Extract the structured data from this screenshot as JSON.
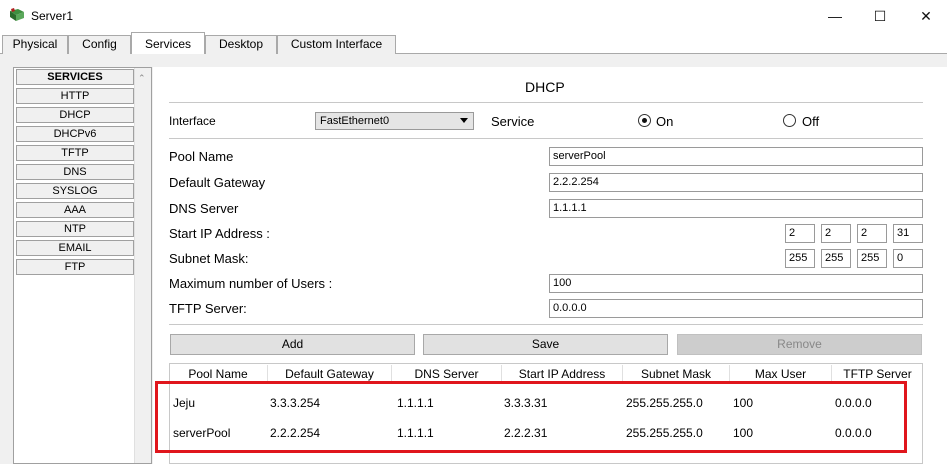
{
  "window": {
    "title": "Server1",
    "minimize": "—",
    "maximize": "☐",
    "close": "✕"
  },
  "tabs": [
    {
      "label": "Physical"
    },
    {
      "label": "Config"
    },
    {
      "label": "Services",
      "active": true
    },
    {
      "label": "Desktop"
    },
    {
      "label": "Custom Interface"
    }
  ],
  "sidebar": {
    "header": "SERVICES",
    "items": [
      "HTTP",
      "DHCP",
      "DHCPv6",
      "TFTP",
      "DNS",
      "SYSLOG",
      "AAA",
      "NTP",
      "EMAIL",
      "FTP"
    ]
  },
  "dhcp": {
    "title": "DHCP",
    "interface_label": "Interface",
    "interface_value": "FastEthernet0",
    "service_label": "Service",
    "on_label": "On",
    "off_label": "Off",
    "service_state": "On",
    "pool_name_label": "Pool Name",
    "pool_name_value": "serverPool",
    "gateway_label": "Default Gateway",
    "gateway_value": "2.2.2.254",
    "dns_label": "DNS Server",
    "dns_value": "1.1.1.1",
    "start_ip_label": "Start IP Address :",
    "start_ip": [
      "2",
      "2",
      "2",
      "31"
    ],
    "mask_label": "Subnet Mask:",
    "mask": [
      "255",
      "255",
      "255",
      "0"
    ],
    "max_users_label": "Maximum number of Users :",
    "max_users_value": "100",
    "tftp_label": "TFTP Server:",
    "tftp_value": "0.0.0.0",
    "buttons": {
      "add": "Add",
      "save": "Save",
      "remove": "Remove"
    }
  },
  "table": {
    "columns": [
      "Pool Name",
      "Default Gateway",
      "DNS Server",
      "Start IP Address",
      "Subnet Mask",
      "Max User",
      "TFTP Server"
    ],
    "rows": [
      [
        "Jeju",
        "3.3.3.254",
        "1.1.1.1",
        "3.3.3.31",
        "255.255.255.0",
        "100",
        "0.0.0.0"
      ],
      [
        "serverPool",
        "2.2.2.254",
        "1.1.1.1",
        "2.2.2.31",
        "255.255.255.0",
        "100",
        "0.0.0.0"
      ]
    ]
  },
  "colors": {
    "highlight": "#e0161c",
    "button_bg": "#e1e1e1",
    "panel_bg": "#f0f0f0"
  }
}
